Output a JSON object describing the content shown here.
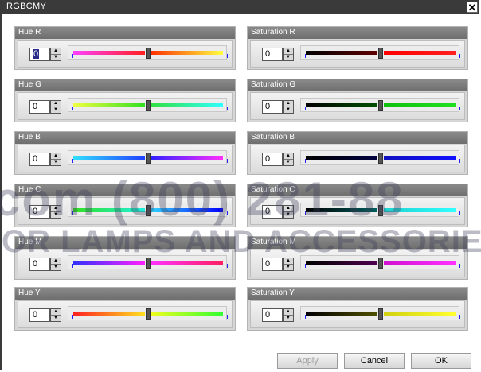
{
  "window": {
    "title": "RGBCMY",
    "close_glyph": "✕"
  },
  "groups": [
    {
      "label": "Hue R",
      "value": "0",
      "colors": [
        "#ff40ff",
        "#ff2020",
        "#ff3000",
        "#ffff40"
      ]
    },
    {
      "label": "Saturation R",
      "value": "0",
      "colors": [
        "#000000",
        "#600000",
        "#ff0000",
        "#ff2020"
      ]
    },
    {
      "label": "Hue G",
      "value": "0",
      "colors": [
        "#f0ff40",
        "#30e020",
        "#30e040",
        "#30ffff"
      ]
    },
    {
      "label": "Saturation G",
      "value": "0",
      "colors": [
        "#000000",
        "#005000",
        "#10c010",
        "#20e020"
      ]
    },
    {
      "label": "Hue B",
      "value": "0",
      "colors": [
        "#30e0ff",
        "#2040ff",
        "#3020ff",
        "#ff30ff"
      ]
    },
    {
      "label": "Saturation B",
      "value": "0",
      "colors": [
        "#000000",
        "#000040",
        "#1010c0",
        "#1010ff"
      ]
    },
    {
      "label": "Hue C",
      "value": "0",
      "colors": [
        "#30e020",
        "#20f0e0",
        "#30d0ff",
        "#0000ff"
      ]
    },
    {
      "label": "Saturation C",
      "value": "0",
      "colors": [
        "#000000",
        "#006060",
        "#20d0d0",
        "#30ffff"
      ]
    },
    {
      "label": "Hue M",
      "value": "0",
      "colors": [
        "#3030ff",
        "#ff20ff",
        "#ff30ff",
        "#ff2060"
      ]
    },
    {
      "label": "Saturation M",
      "value": "0",
      "colors": [
        "#000000",
        "#500050",
        "#d010d0",
        "#ff30ff"
      ]
    },
    {
      "label": "Hue Y",
      "value": "0",
      "colors": [
        "#ff2020",
        "#ffe020",
        "#f0ff20",
        "#30ff30"
      ]
    },
    {
      "label": "Saturation Y",
      "value": "0",
      "colors": [
        "#000000",
        "#505000",
        "#d0d010",
        "#ffff30"
      ]
    }
  ],
  "buttons": {
    "apply": "Apply",
    "cancel": "Cancel",
    "ok": "OK"
  },
  "watermark": {
    "line1": "com (800) 281-88",
    "line2": "OR LAMPS AND ACCESSORIES"
  },
  "colors": {
    "titlebar": "#3a3a3a",
    "group_header": "#7a7a7a",
    "group_bg": "#d6d6d6"
  }
}
